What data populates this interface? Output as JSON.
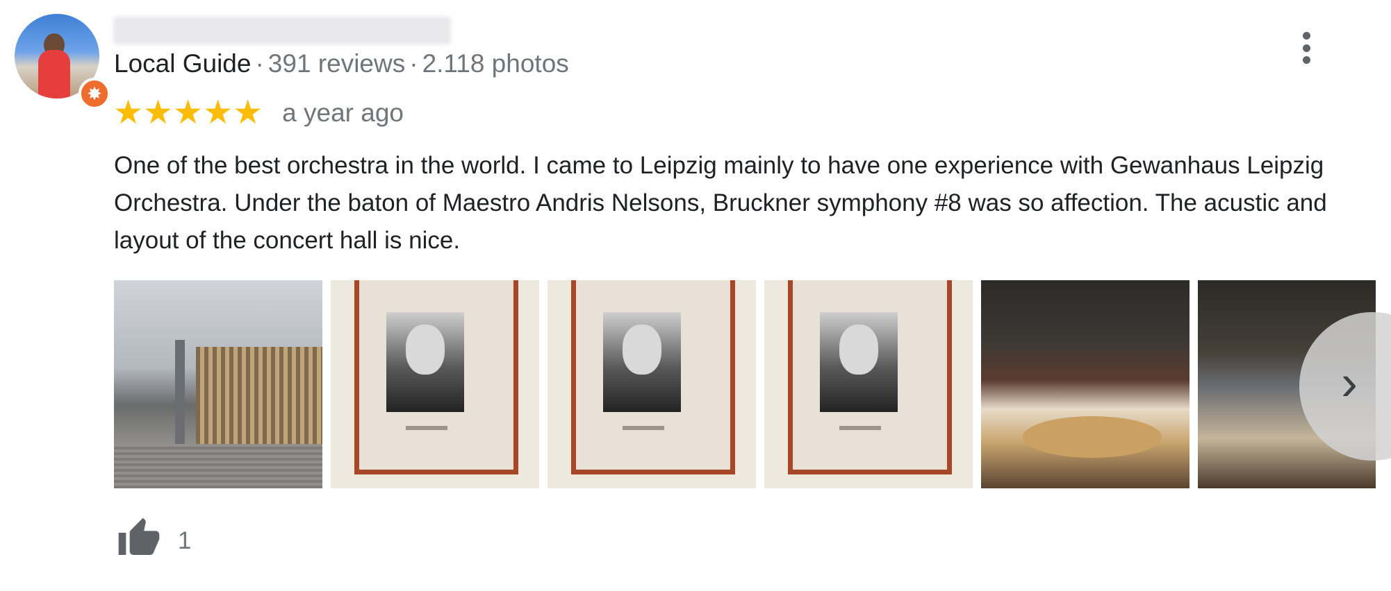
{
  "reviewer": {
    "name": "",
    "local_guide_label": "Local Guide",
    "reviews": "391 reviews",
    "photos": "2.118 photos",
    "separator": "·"
  },
  "review": {
    "rating": 5,
    "stars": "★★★★★",
    "date": "a year ago",
    "text": "One of the best orchestra in the world. I came to Leipzig mainly to have one experience with Gewanhaus Leipzig Orchestra. Under the baton of Maestro Andris Nelsons, Bruckner symphony #8 was so affection. The acustic and layout of the concert hall is nice."
  },
  "photos": [
    {
      "subject": "Gewandhaus exterior and square"
    },
    {
      "subject": "framed portrait of conductor"
    },
    {
      "subject": "framed portrait of conductor"
    },
    {
      "subject": "framed portrait of conductor"
    },
    {
      "subject": "concert hall interior with orchestra"
    },
    {
      "subject": "concert hall interior seating"
    }
  ],
  "carousel": {
    "next_icon": "›"
  },
  "likes": {
    "count": "1"
  },
  "icons": {
    "more": "more-vert-icon",
    "like": "thumbs-up-icon",
    "badge": "local-guide-badge-icon",
    "next": "chevron-right-icon"
  },
  "colors": {
    "star": "#fbbc04",
    "secondary_text": "#70757a",
    "badge": "#ef6c2f"
  }
}
